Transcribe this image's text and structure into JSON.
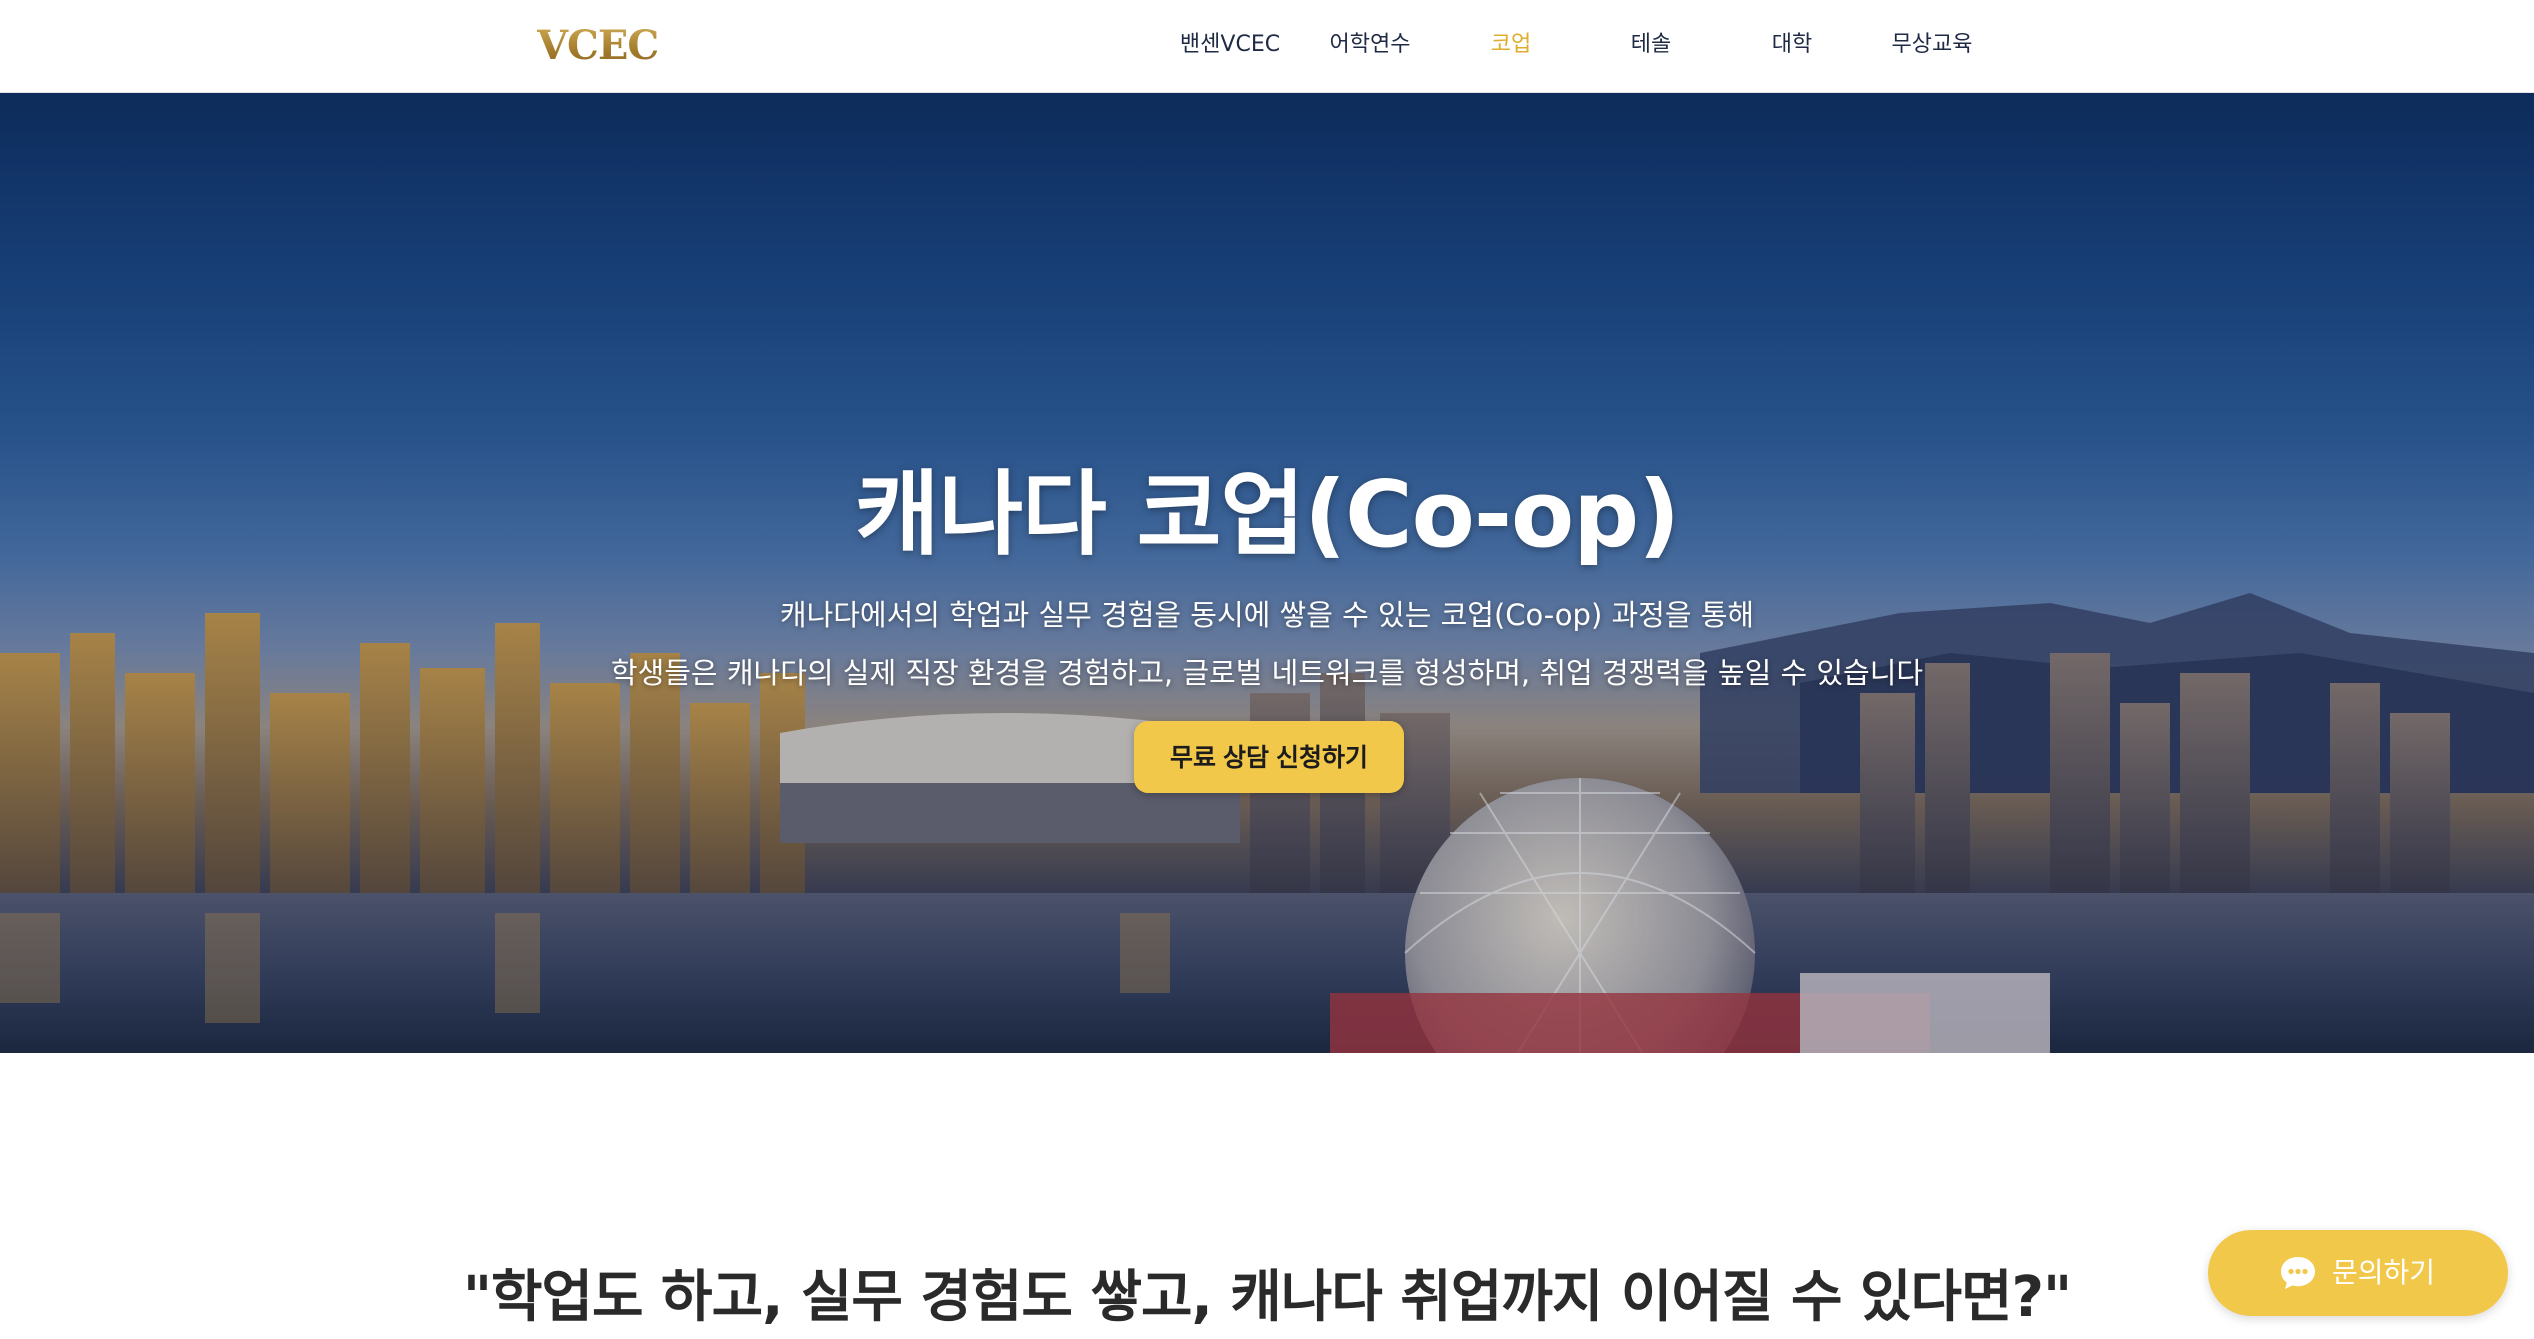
{
  "header": {
    "logo": "VCEC",
    "nav": [
      {
        "label": "밴센VCEC",
        "active": false
      },
      {
        "label": "어학연수",
        "active": false
      },
      {
        "label": "코업",
        "active": true
      },
      {
        "label": "테솔",
        "active": false
      },
      {
        "label": "대학",
        "active": false
      },
      {
        "label": "무상교육",
        "active": false
      }
    ]
  },
  "hero": {
    "title": "캐나다 코업(Co-op)",
    "subtitle_line1": "캐나다에서의 학업과 실무 경험을 동시에 쌓을 수 있는 코업(Co-op) 과정을 통해",
    "subtitle_line2": "학생들은 캐나다의 실제 직장 환경을 경험하고, 글로벌 네트워크를 형성하며, 취업 경쟁력을 높일 수 있습니다",
    "cta_label": "무료 상담 신청하기",
    "image": "vancouver-city-skyline-photo"
  },
  "quote": {
    "text": "\"학업도 하고, 실무 경험도 쌓고, 캐나다 취업까지 이어질 수 있다면?\""
  },
  "chat": {
    "label": "문의하기",
    "icon": "chat-bubble-icon"
  },
  "colors": {
    "accent": "#f2c84b",
    "active_nav": "#e0ad2c",
    "nav_text": "#1f2a44",
    "logo_gold": "#b08a3c"
  }
}
